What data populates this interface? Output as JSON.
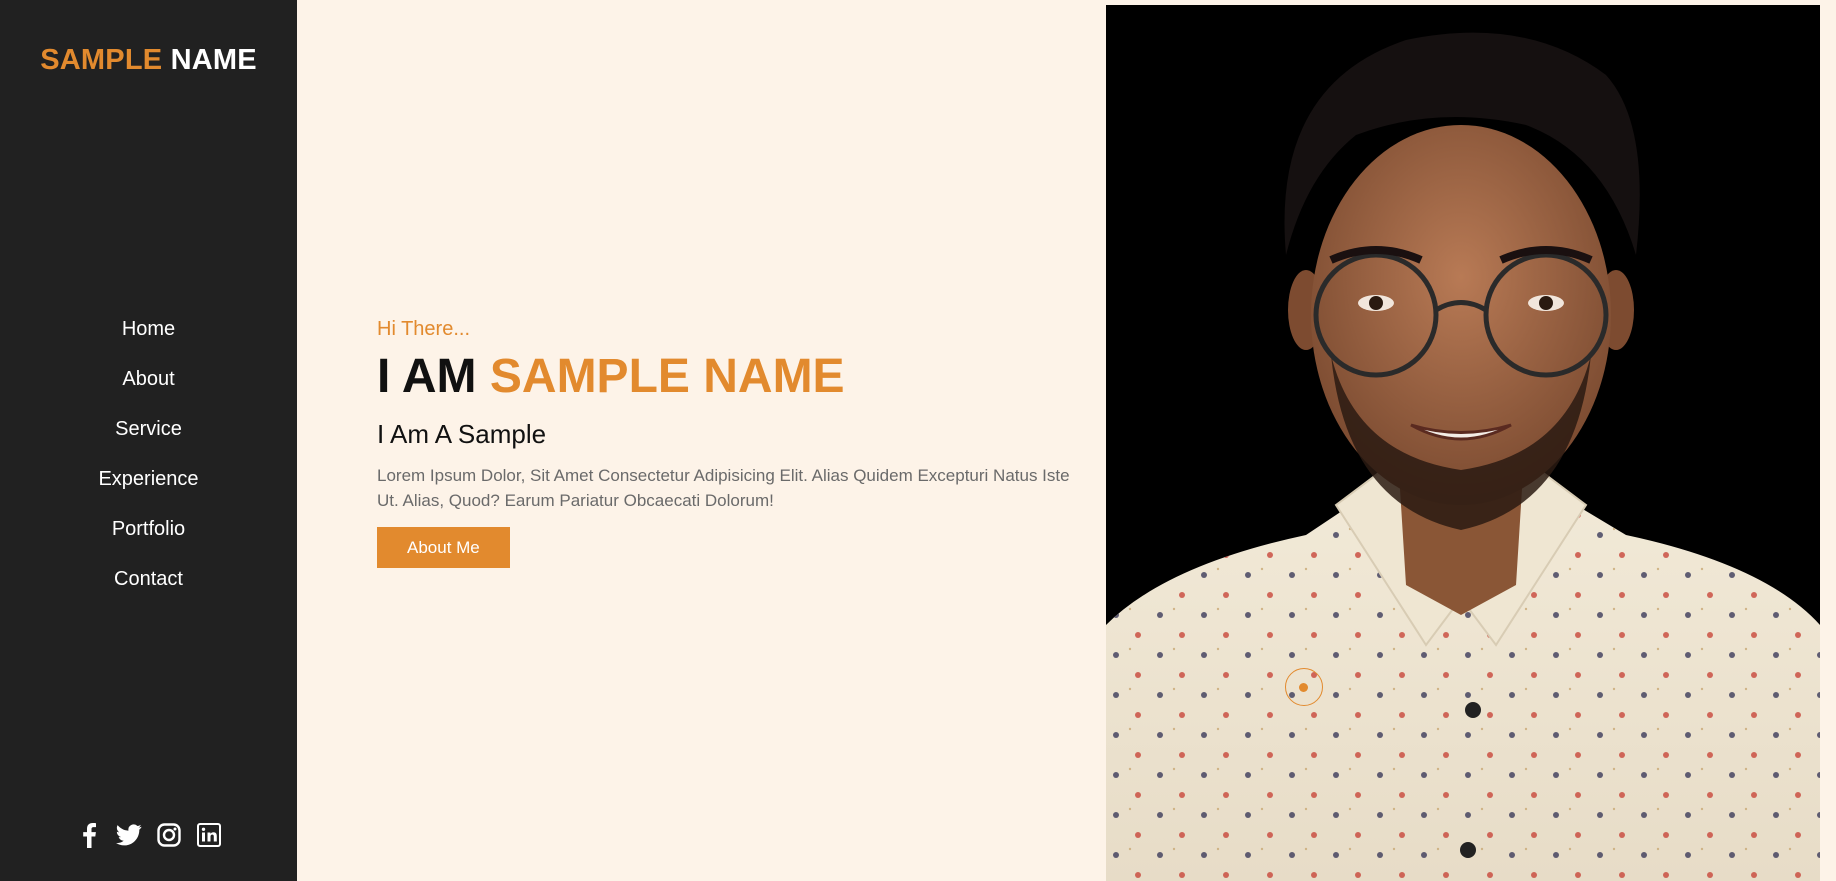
{
  "brand": {
    "first": "SAMPLE",
    "second": "NAME"
  },
  "nav": [
    "Home",
    "About",
    "Service",
    "Experience",
    "Portfolio",
    "Contact"
  ],
  "social": [
    "facebook-icon",
    "twitter-icon",
    "instagram-icon",
    "linkedin-icon"
  ],
  "hero": {
    "greeting": "Hi There...",
    "headline_prefix": "I AM",
    "headline_name": "SAMPLE NAME",
    "subtitle": "I Am A Sample",
    "description": "Lorem Ipsum Dolor, Sit Amet Consectetur Adipisicing Elit. Alias Quidem Excepturi Natus Iste Ut. Alias, Quod? Earum Pariatur Obcaecati Dolorum!",
    "button": "About Me"
  },
  "colors": {
    "accent": "#e28a2e",
    "sidebar": "#212121",
    "background": "#fdf3e8"
  }
}
